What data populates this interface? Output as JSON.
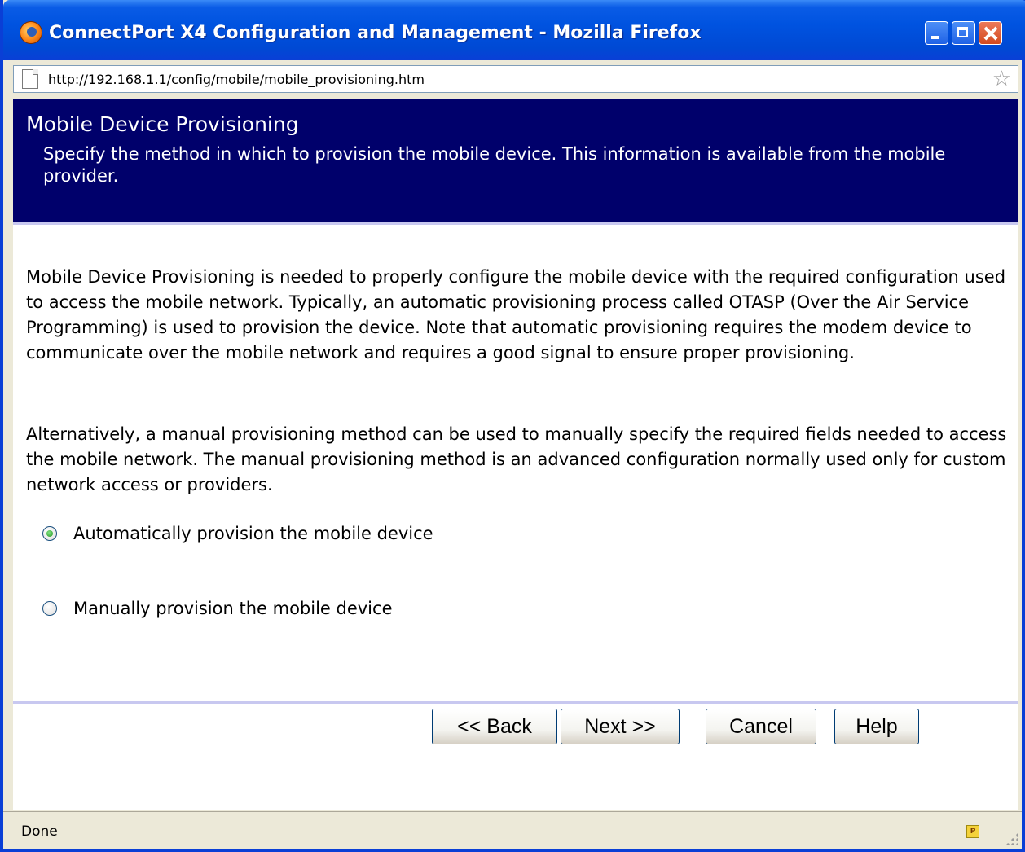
{
  "window": {
    "title": "ConnectPort X4 Configuration and Management - Mozilla Firefox"
  },
  "addressbar": {
    "url": "http://192.168.1.1/config/mobile/mobile_provisioning.htm"
  },
  "header": {
    "title": "Mobile Device Provisioning",
    "subtitle": "Specify the method in which to provision the mobile device. This information is available from the mobile provider."
  },
  "body": {
    "paragraph1": "Mobile Device Provisioning is needed to properly configure the mobile device with the required configuration used to access the mobile network. Typically, an automatic provisioning process called OTASP (Over the Air Service Programming) is used to provision the device. Note that automatic provisioning requires the modem device to communicate over the mobile network and requires a good signal to ensure proper provisioning.",
    "paragraph2": "Alternatively, a manual provisioning method can be used to manually specify the required fields needed to access the mobile network. The manual provisioning method is an advanced configuration normally used only for custom network access or providers."
  },
  "options": [
    {
      "label": "Automatically provision the mobile device",
      "checked": true
    },
    {
      "label": "Manually provision the mobile device",
      "checked": false
    }
  ],
  "buttons": {
    "back": "<< Back",
    "next": "Next >>",
    "cancel": "Cancel",
    "help": "Help"
  },
  "statusbar": {
    "text": "Done",
    "plugin_icon_label": "P"
  },
  "colors": {
    "header_band": "#00006b",
    "titlebar": "#0053e0",
    "radio_checked": "#2a9a2a"
  }
}
